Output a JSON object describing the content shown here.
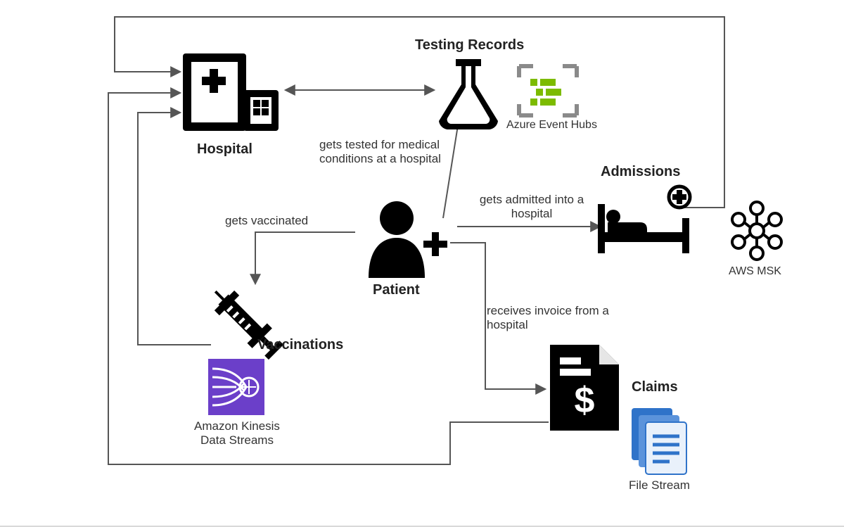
{
  "nodes": {
    "hospital": {
      "label": "Hospital"
    },
    "patient": {
      "label": "Patient"
    },
    "testing": {
      "label": "Testing Records",
      "service": "Azure Event Hubs"
    },
    "admissions": {
      "label": "Admissions",
      "service": "AWS MSK"
    },
    "claims": {
      "label": "Claims",
      "service": "File Stream"
    },
    "vaccinations": {
      "label": "Vaccinations",
      "service": "Amazon Kinesis\nData Streams"
    }
  },
  "edges": {
    "patient_testing": {
      "label": "gets tested for medical\nconditions at a hospital"
    },
    "patient_admissions": {
      "label": "gets admitted into a\nhospital"
    },
    "patient_claims": {
      "label": "receives invoice from a\nhospital"
    },
    "patient_vacc": {
      "label": "gets vaccinated"
    }
  }
}
